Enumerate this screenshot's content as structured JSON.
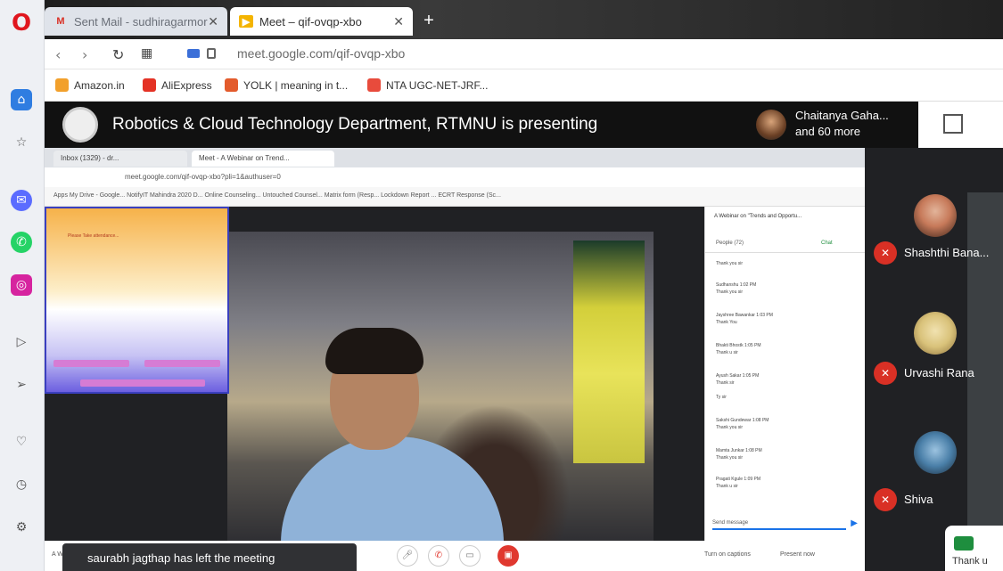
{
  "browser": {
    "tabs": [
      {
        "label": "Sent Mail - sudhiragarmor",
        "favicon": "gmail-icon",
        "active": false
      },
      {
        "label": "Meet – qif-ovqp-xbo",
        "favicon": "meet-icon",
        "active": true
      }
    ],
    "url": "meet.google.com/qif-ovqp-xbo",
    "bookmarks": [
      {
        "label": "Amazon.in",
        "icon": "amazon-icon",
        "color": "#f2a02b"
      },
      {
        "label": "AliExpress",
        "icon": "aliexpress-icon",
        "color": "#e43225"
      },
      {
        "label": "YOLK | meaning in t...",
        "icon": "yolk-icon",
        "color": "#e35b2c"
      },
      {
        "label": "NTA UGC-NET-JRF...",
        "icon": "nta-icon",
        "color": "#e84b3c"
      }
    ]
  },
  "meet": {
    "presenting_title": "Robotics & Cloud Technology Department, RTMNU is presenting",
    "presenter_name": "Chaitanya Gaha...",
    "presenter_more": "and 60 more",
    "toast": "saurabh jagthap has left the meeting",
    "participants": [
      {
        "name": "Shashthi Bana...",
        "avatar_color": "#c77a5a"
      },
      {
        "name": "Urvashi Rana",
        "avatar_color": "#d9c27a"
      },
      {
        "name": "Shiva",
        "avatar_color": "#4a7fa8"
      }
    ],
    "chat_fab_text": "Thank u"
  },
  "shared_screen": {
    "inner_tab_1": "Inbox (1329) - dr...",
    "inner_tab_2": "Meet - A Webinar on Trend...",
    "inner_url": "meet.google.com/qif-ovqp-xbo?pli=1&authuser=0",
    "inner_bookmarks": "Apps   My Drive - Google...   NotifyIT   Mahindra 2020 D...   Online Counseling...   Untouched Counsel...   Matrix form (Resp...   Lockdown Report ...   ECRT Response (Sc...",
    "popup_text": "Please Take attendance...",
    "chat_header": "A Webinar on \"Trends and Opportu...",
    "chat_tab_people": "People (72)",
    "chat_tab_chat": "Chat",
    "chat_messages": [
      {
        "name": "",
        "text": "Thank you sir"
      },
      {
        "name": "Sudhanshu 1:02 PM",
        "text": "Thank you sir"
      },
      {
        "name": "Jayshree Bawankar 1:03 PM",
        "text": "Thank You"
      },
      {
        "name": "Bhakti Bhostk 1:05 PM",
        "text": "Thank u sir"
      },
      {
        "name": "Ayush Sakar 1:05 PM",
        "text": "Thank sir"
      },
      {
        "name": "",
        "text": "Ty sir"
      },
      {
        "name": "Sakshi Gundewar 1:08 PM",
        "text": "Thank you sir"
      },
      {
        "name": "Mamta Junkar 1:08 PM",
        "text": "Thank you sir"
      },
      {
        "name": "Pragati Kgule 1:09 PM",
        "text": "Thank u sir"
      }
    ],
    "chat_input_placeholder": "Send message",
    "ctrl_left_label": "A Webinar",
    "ctrl_right_label_1": "Turn on captions",
    "ctrl_right_label_2": "Present now"
  }
}
